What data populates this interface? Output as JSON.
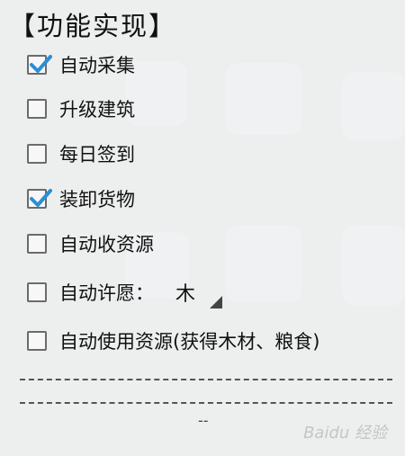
{
  "panel": {
    "title": "【功能实现】",
    "items": [
      {
        "label": "自动采集",
        "checked": true
      },
      {
        "label": "升级建筑",
        "checked": false
      },
      {
        "label": "每日签到",
        "checked": false
      },
      {
        "label": "装卸货物",
        "checked": true
      },
      {
        "label": "自动收资源",
        "checked": false
      },
      {
        "label": "自动许愿：",
        "checked": false,
        "select_value": "木"
      },
      {
        "label": "自动使用资源(获得木材、粮食)",
        "checked": false
      }
    ],
    "tail_text": "--",
    "check_color": "#2a8fd6"
  },
  "watermark": "Baidu 经验"
}
